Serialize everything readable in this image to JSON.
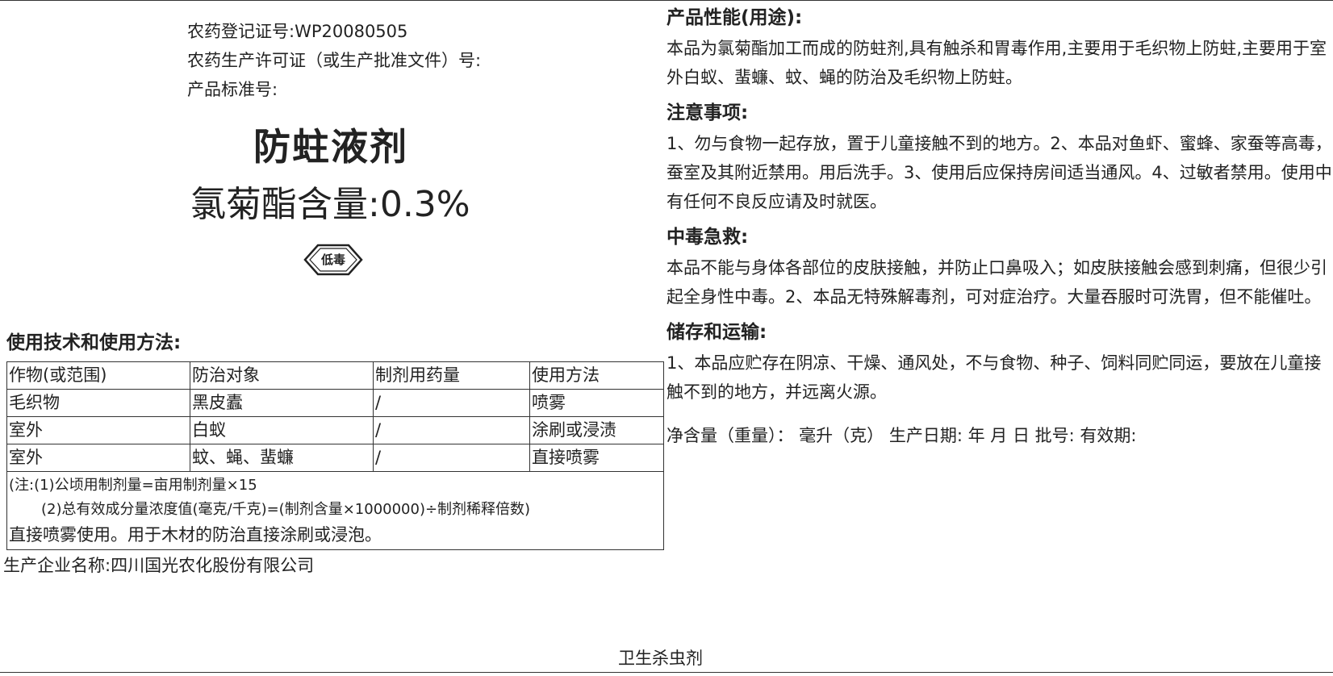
{
  "registration": {
    "reg_no": "农药登记证号:WP20080505",
    "permit_no": "农药生产许可证（或生产批准文件）号:",
    "standard_no": "产品标准号:"
  },
  "product": {
    "name": "防蛀液剂",
    "content": "氯菊酯含量:0.3%",
    "toxicity": "低毒"
  },
  "usage": {
    "heading": "使用技术和使用方法:",
    "columns": [
      "作物(或范围)",
      "防治对象",
      "制剂用药量",
      "使用方法"
    ],
    "rows": [
      [
        "毛织物",
        "黑皮蠹",
        "/",
        "喷雾"
      ],
      [
        "室外",
        "白蚁",
        "/",
        "涂刷或浸渍"
      ],
      [
        "室外",
        "蚊、蝇、蜚蠊",
        "/",
        "直接喷雾"
      ]
    ],
    "note1": "(注:(1)公顷用制剂量=亩用制剂量×15",
    "note2": "(2)总有效成分量浓度值(毫克/千克)=(制剂含量×1000000)÷制剂稀释倍数)",
    "note3": "直接喷雾使用。用于木材的防治直接涂刷或浸泡。"
  },
  "manufacturer": "生产企业名称:四川国光农化股份有限公司",
  "performance": {
    "heading": "产品性能(用途):",
    "text": "本品为氯菊酯加工而成的防蛀剂,具有触杀和胃毒作用,主要用于毛织物上防蛀,主要用于室外白蚁、蜚蠊、蚊、蝇的防治及毛织物上防蛀。"
  },
  "precautions": {
    "heading": "注意事项:",
    "text": "1、勿与食物一起存放，置于儿童接触不到的地方。2、本品对鱼虾、蜜蜂、家蚕等高毒，蚕室及其附近禁用。用后洗手。3、使用后应保持房间适当通风。4、过敏者禁用。使用中有任何不良反应请及时就医。"
  },
  "first_aid": {
    "heading": "中毒急救:",
    "text": "本品不能与身体各部位的皮肤接触，并防止口鼻吸入；如皮肤接触会感到刺痛，但很少引起全身性中毒。2、本品无特殊解毒剂，可对症治疗。大量吞服时可洗胃，但不能催吐。"
  },
  "storage": {
    "heading": "储存和运输:",
    "text": "1、本品应贮存在阴凉、干燥、通风处，不与食物、种子、饲料同贮同运，要放在儿童接触不到的地方，并远离火源。"
  },
  "footer_info": "净含量（重量）： 毫升（克） 生产日期: 年 月 日 批号: 有效期:",
  "category": "卫生杀虫剂"
}
